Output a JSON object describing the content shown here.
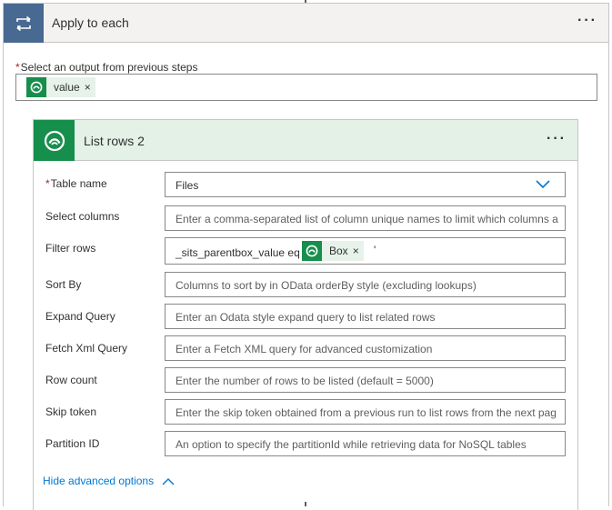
{
  "loop": {
    "title": "Apply to each",
    "menu": "···",
    "output_label": "Select an output from previous steps",
    "required_mark": "*",
    "output_token": {
      "label": "value",
      "remove": "×"
    }
  },
  "action": {
    "title": "List rows 2",
    "menu": "···",
    "fields": {
      "table_name": {
        "label": "Table name",
        "required": "*",
        "value": "Files"
      },
      "select_columns": {
        "label": "Select columns",
        "placeholder": "Enter a comma-separated list of column unique names to limit which columns a"
      },
      "filter_rows": {
        "label": "Filter rows",
        "prefix": "_sits_parentbox_value eq '",
        "token": "Box",
        "remove": "×",
        "suffix": "'"
      },
      "sort_by": {
        "label": "Sort By",
        "placeholder": "Columns to sort by in OData orderBy style (excluding lookups)"
      },
      "expand_query": {
        "label": "Expand Query",
        "placeholder": "Enter an Odata style expand query to list related rows"
      },
      "fetch_xml": {
        "label": "Fetch Xml Query",
        "placeholder": "Enter a Fetch XML query for advanced customization"
      },
      "row_count": {
        "label": "Row count",
        "placeholder": "Enter the number of rows to be listed (default = 5000)"
      },
      "skip_token": {
        "label": "Skip token",
        "placeholder": "Enter the skip token obtained from a previous run to list rows from the next pag"
      },
      "partition_id": {
        "label": "Partition ID",
        "placeholder": "An option to specify the partitionId while retrieving data for NoSQL tables"
      }
    },
    "advanced_link": "Hide advanced options"
  },
  "icons": {
    "loop": "loop-icon",
    "dataverse": "dataverse-icon",
    "dropdown": "chevron-down-icon",
    "collapse": "chevron-up-icon"
  },
  "colors": {
    "loop_accent": "#486991",
    "dataverse_green": "#168f4c",
    "dataverse_header": "#e3f1e7",
    "link": "#0078d4",
    "required": "#a4262c"
  }
}
